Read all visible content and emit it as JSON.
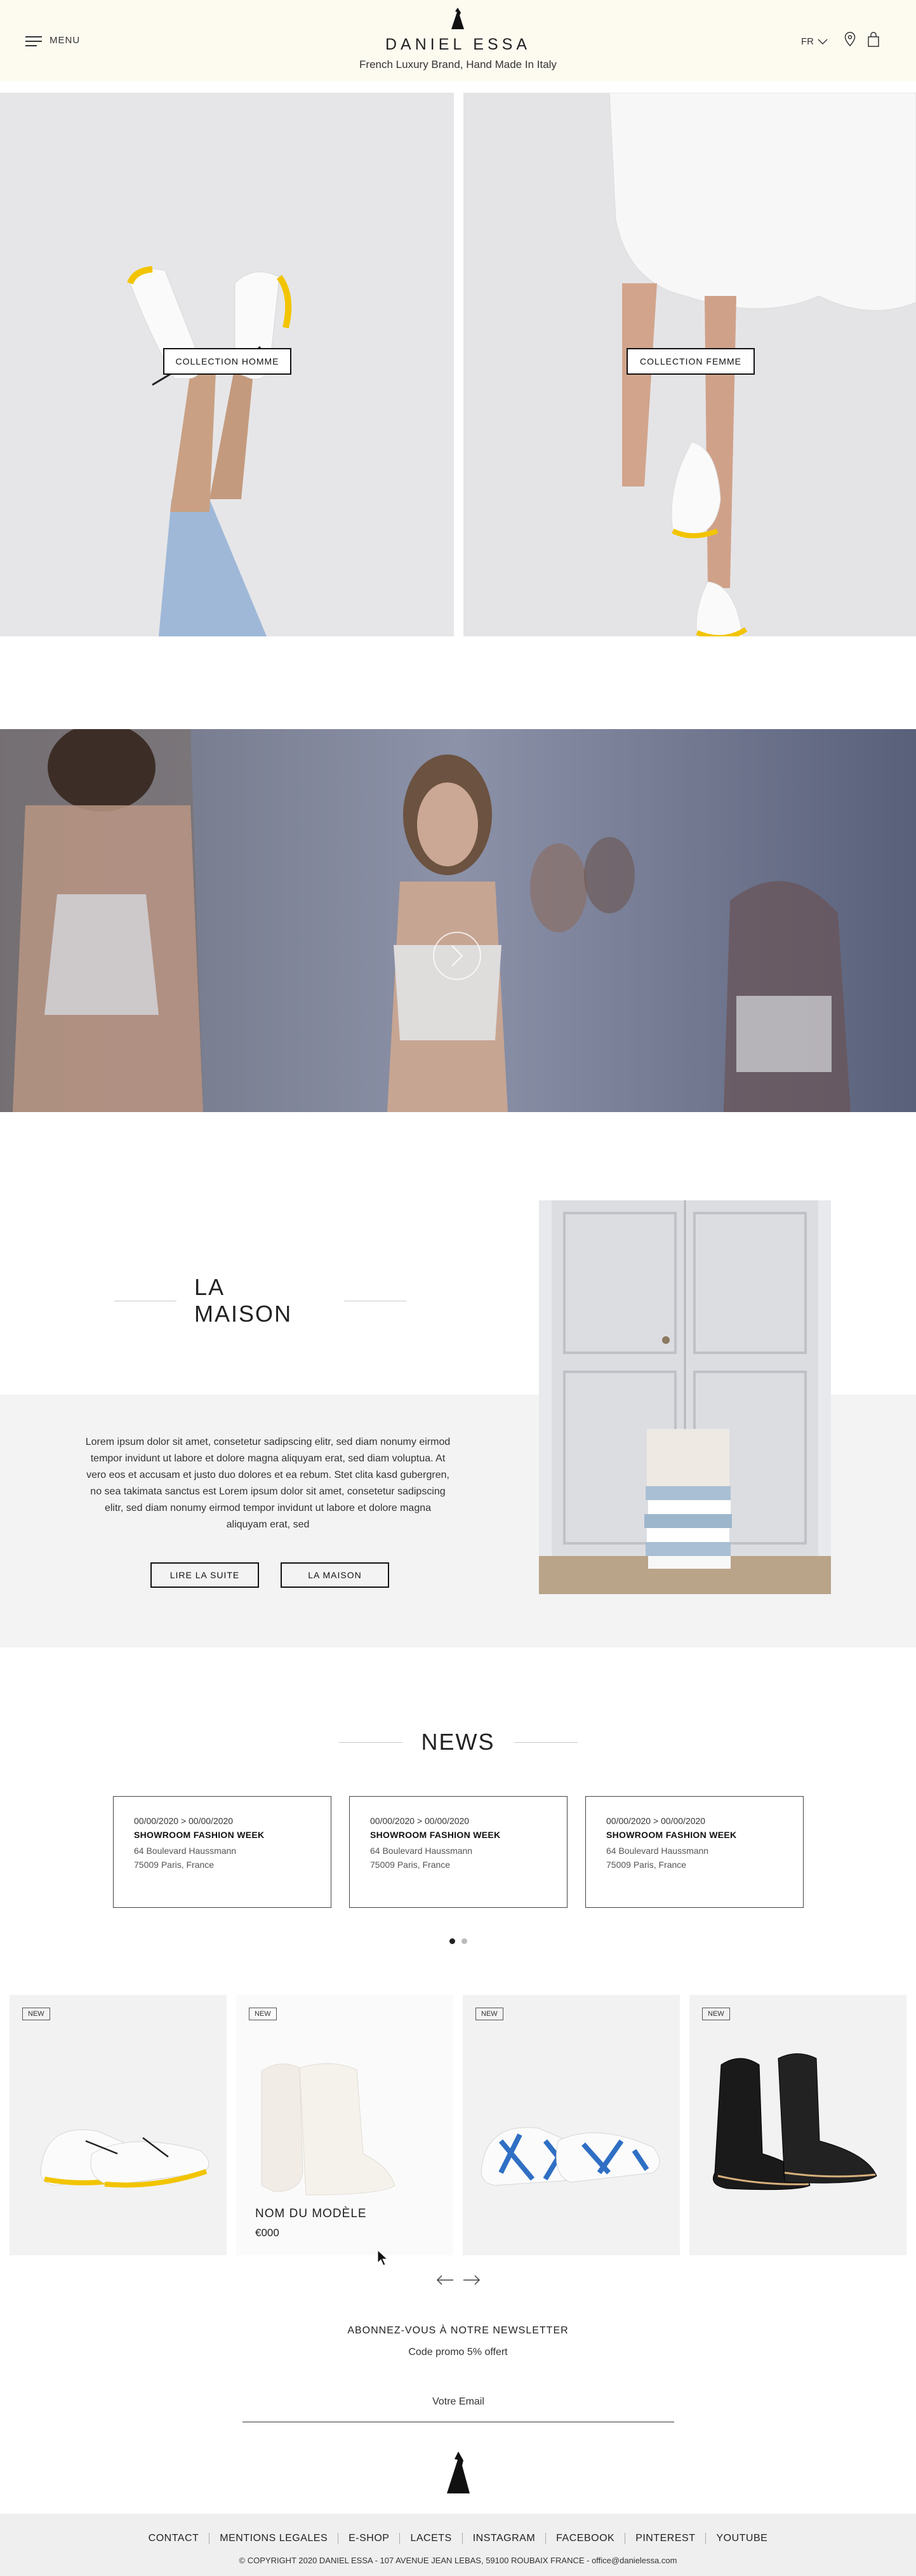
{
  "header": {
    "menu_label": "MENU",
    "brand": "DANIEL ESSA",
    "tagline": "French Luxury Brand, Hand Made In Italy",
    "language": "FR"
  },
  "collections": [
    {
      "label": "COLLECTION HOMME"
    },
    {
      "label": "COLLECTION FEMME"
    }
  ],
  "maison": {
    "title": "LA MAISON",
    "text": "Lorem ipsum dolor sit amet, consetetur sadipscing elitr, sed diam nonumy eirmod tempor invidunt ut labore et dolore magna aliquyam erat, sed diam voluptua. At vero eos et accusam et justo duo dolores et ea rebum. Stet clita kasd gubergren, no sea takimata sanctus est Lorem ipsum dolor sit amet, consetetur sadipscing elitr, sed diam nonumy eirmod tempor invidunt ut labore et dolore magna aliquyam erat, sed",
    "read_more": "LIRE LA SUITE",
    "button": "LA MAISON"
  },
  "news": {
    "title": "NEWS",
    "items": [
      {
        "date": "00/00/2020 > 00/00/2020",
        "title": "SHOWROOM FASHION WEEK",
        "address1": "64 Boulevard Haussmann",
        "address2": "75009 Paris, France"
      },
      {
        "date": "00/00/2020 > 00/00/2020",
        "title": "SHOWROOM FASHION WEEK",
        "address1": "64 Boulevard Haussmann",
        "address2": "75009 Paris, France"
      },
      {
        "date": "00/00/2020 > 00/00/2020",
        "title": "SHOWROOM FASHION WEEK",
        "address1": "64 Boulevard Haussmann",
        "address2": "75009 Paris, France"
      }
    ],
    "pages": 2,
    "active_page": 1
  },
  "products": [
    {
      "badge": "NEW"
    },
    {
      "badge": "NEW",
      "name": "NOM DU MODÈLE",
      "price": "€000"
    },
    {
      "badge": "NEW"
    },
    {
      "badge": "NEW"
    }
  ],
  "newsletter": {
    "title": "ABONNEZ-VOUS À NOTRE NEWSLETTER",
    "promo": "Code promo 5% offert",
    "placeholder": "Votre Email"
  },
  "footer": {
    "links": [
      "CONTACT",
      "MENTIONS LEGALES",
      "E-SHOP",
      "LACETS",
      "INSTAGRAM",
      "FACEBOOK",
      "PINTEREST",
      "YOUTUBE"
    ],
    "copyright": "© COPYRIGHT 2020 DANIEL ESSA - 107 AVENUE JEAN LEBAS, 59100 ROUBAIX FRANCE - office@danielessa.com"
  },
  "colors": {
    "header_bg": "#fdfaf0",
    "sole_yellow": "#f2c400",
    "gray_bg": "#f3f3f3"
  }
}
